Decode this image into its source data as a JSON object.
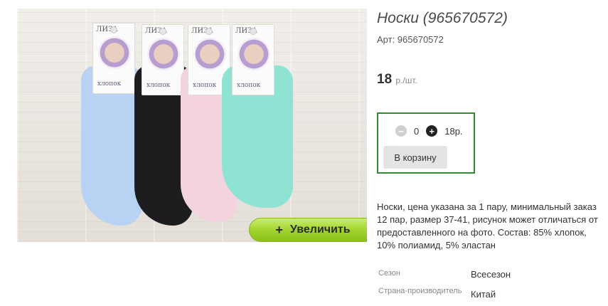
{
  "product": {
    "title": "Носки (965670572)",
    "sku_label": "Арт: 965670572",
    "price_value": "18",
    "price_unit": "р./шт.",
    "zoom_label": "Увеличить",
    "zoom_icon": "+",
    "photo_cards": [
      {
        "brand": "ЛИЗА",
        "caption": "хлопок"
      },
      {
        "brand": "ЛИЗА",
        "caption": "хлопок"
      },
      {
        "brand": "ЛИЗА",
        "caption": "хлопок"
      },
      {
        "brand": "ЛИЗА",
        "caption": "хлопок"
      }
    ],
    "sock_colors": [
      "#b7d2f2",
      "#1d1d1f",
      "#f2d3de",
      "#8fe3d2"
    ]
  },
  "cart": {
    "quantity": "0",
    "total": "18р.",
    "minus_icon": "−",
    "plus_icon": "+",
    "add_button": "В корзину",
    "border_color": "#2e8b2e"
  },
  "description": "Носки, цена указана за 1 пару, минимальный заказ 12 пар, размер 37-41, рисунок может отличаться от предоставленного на фото. Состав: 85% хлопок, 10% полиамид, 5% эластан",
  "properties": [
    {
      "key": "Сезон",
      "value": "Всесезон"
    },
    {
      "key": "Страна-производитель",
      "value": "Китай"
    }
  ]
}
